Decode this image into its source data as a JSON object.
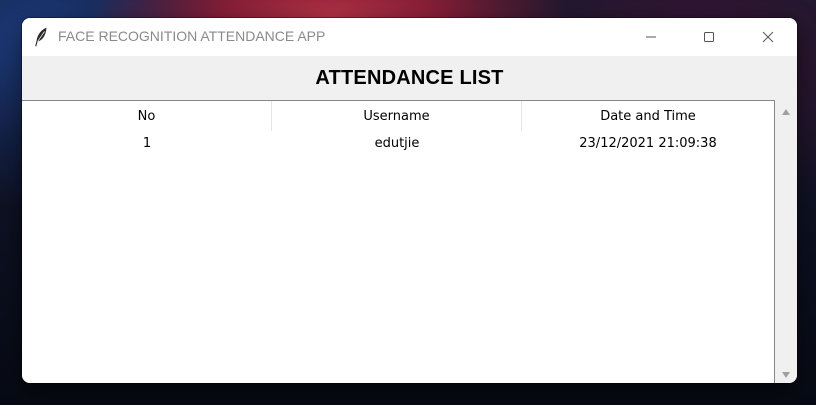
{
  "window": {
    "title": "FACE RECOGNITION ATTENDANCE APP",
    "app_icon": "feather-icon",
    "controls": {
      "minimize": "minimize-icon",
      "maximize": "maximize-icon",
      "close": "close-icon"
    }
  },
  "header": {
    "title": "ATTENDANCE LIST"
  },
  "table": {
    "columns": [
      "No",
      "Username",
      "Date and Time"
    ],
    "rows": [
      [
        "1",
        "edutjie",
        "23/12/2021 21:09:38"
      ]
    ]
  },
  "colors": {
    "header_bg": "#f0f0f0",
    "window_bg": "#ffffff",
    "title_text": "#8a8a8a"
  }
}
